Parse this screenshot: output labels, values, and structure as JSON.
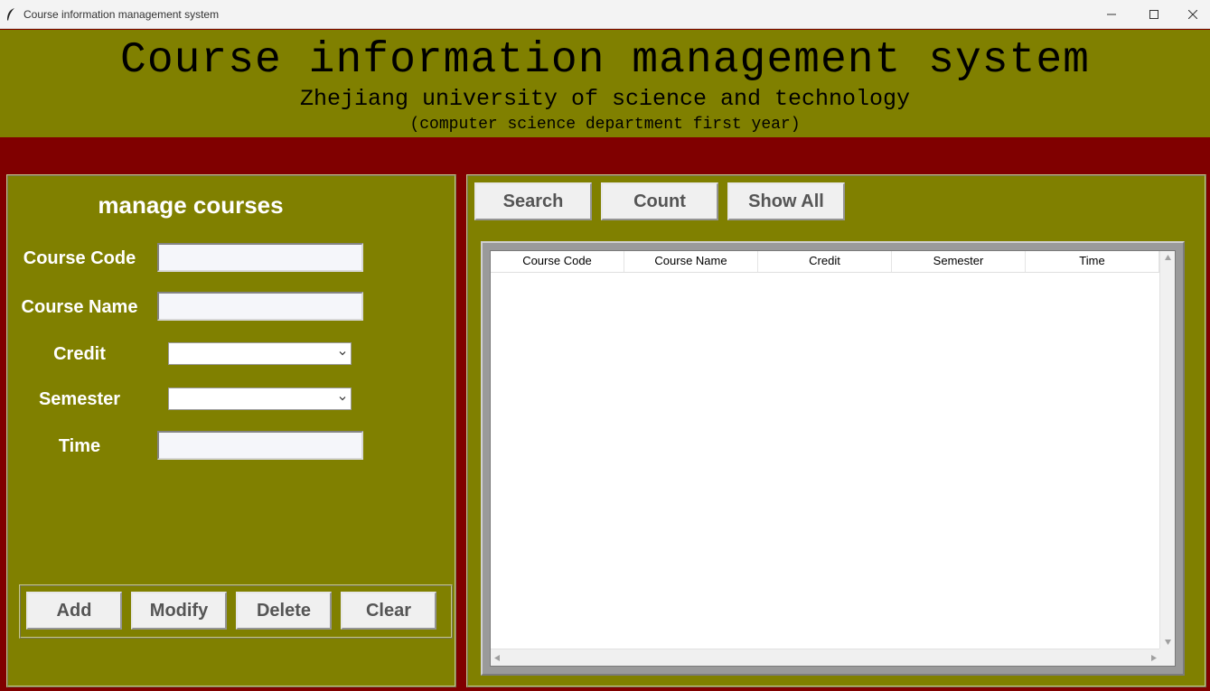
{
  "window": {
    "title": "Course information management system",
    "feather_icon": "feather-icon",
    "controls": [
      "minimize-icon",
      "maximize-icon",
      "close-icon"
    ]
  },
  "header": {
    "title": "Course information management system",
    "subtitle": "Zhejiang university of science and technology",
    "note": "(computer science department first year)"
  },
  "manage": {
    "title": "manage courses",
    "fields": {
      "course_code": {
        "label": "Course Code",
        "value": ""
      },
      "course_name": {
        "label": "Course Name",
        "value": ""
      },
      "credit": {
        "label": "Credit",
        "value": ""
      },
      "semester": {
        "label": "Semester",
        "value": ""
      },
      "time": {
        "label": "Time",
        "value": ""
      }
    },
    "buttons": {
      "add": "Add",
      "modify": "Modify",
      "delete": "Delete",
      "clear": "Clear"
    }
  },
  "toolbar": {
    "search": "Search",
    "count": "Count",
    "show_all": "Show All"
  },
  "table": {
    "columns": [
      "Course Code",
      "Course Name",
      "Credit",
      "Semester",
      "Time"
    ],
    "rows": []
  },
  "colors": {
    "background": "#800000",
    "panel": "#808000",
    "button": "#f0f0f0"
  }
}
